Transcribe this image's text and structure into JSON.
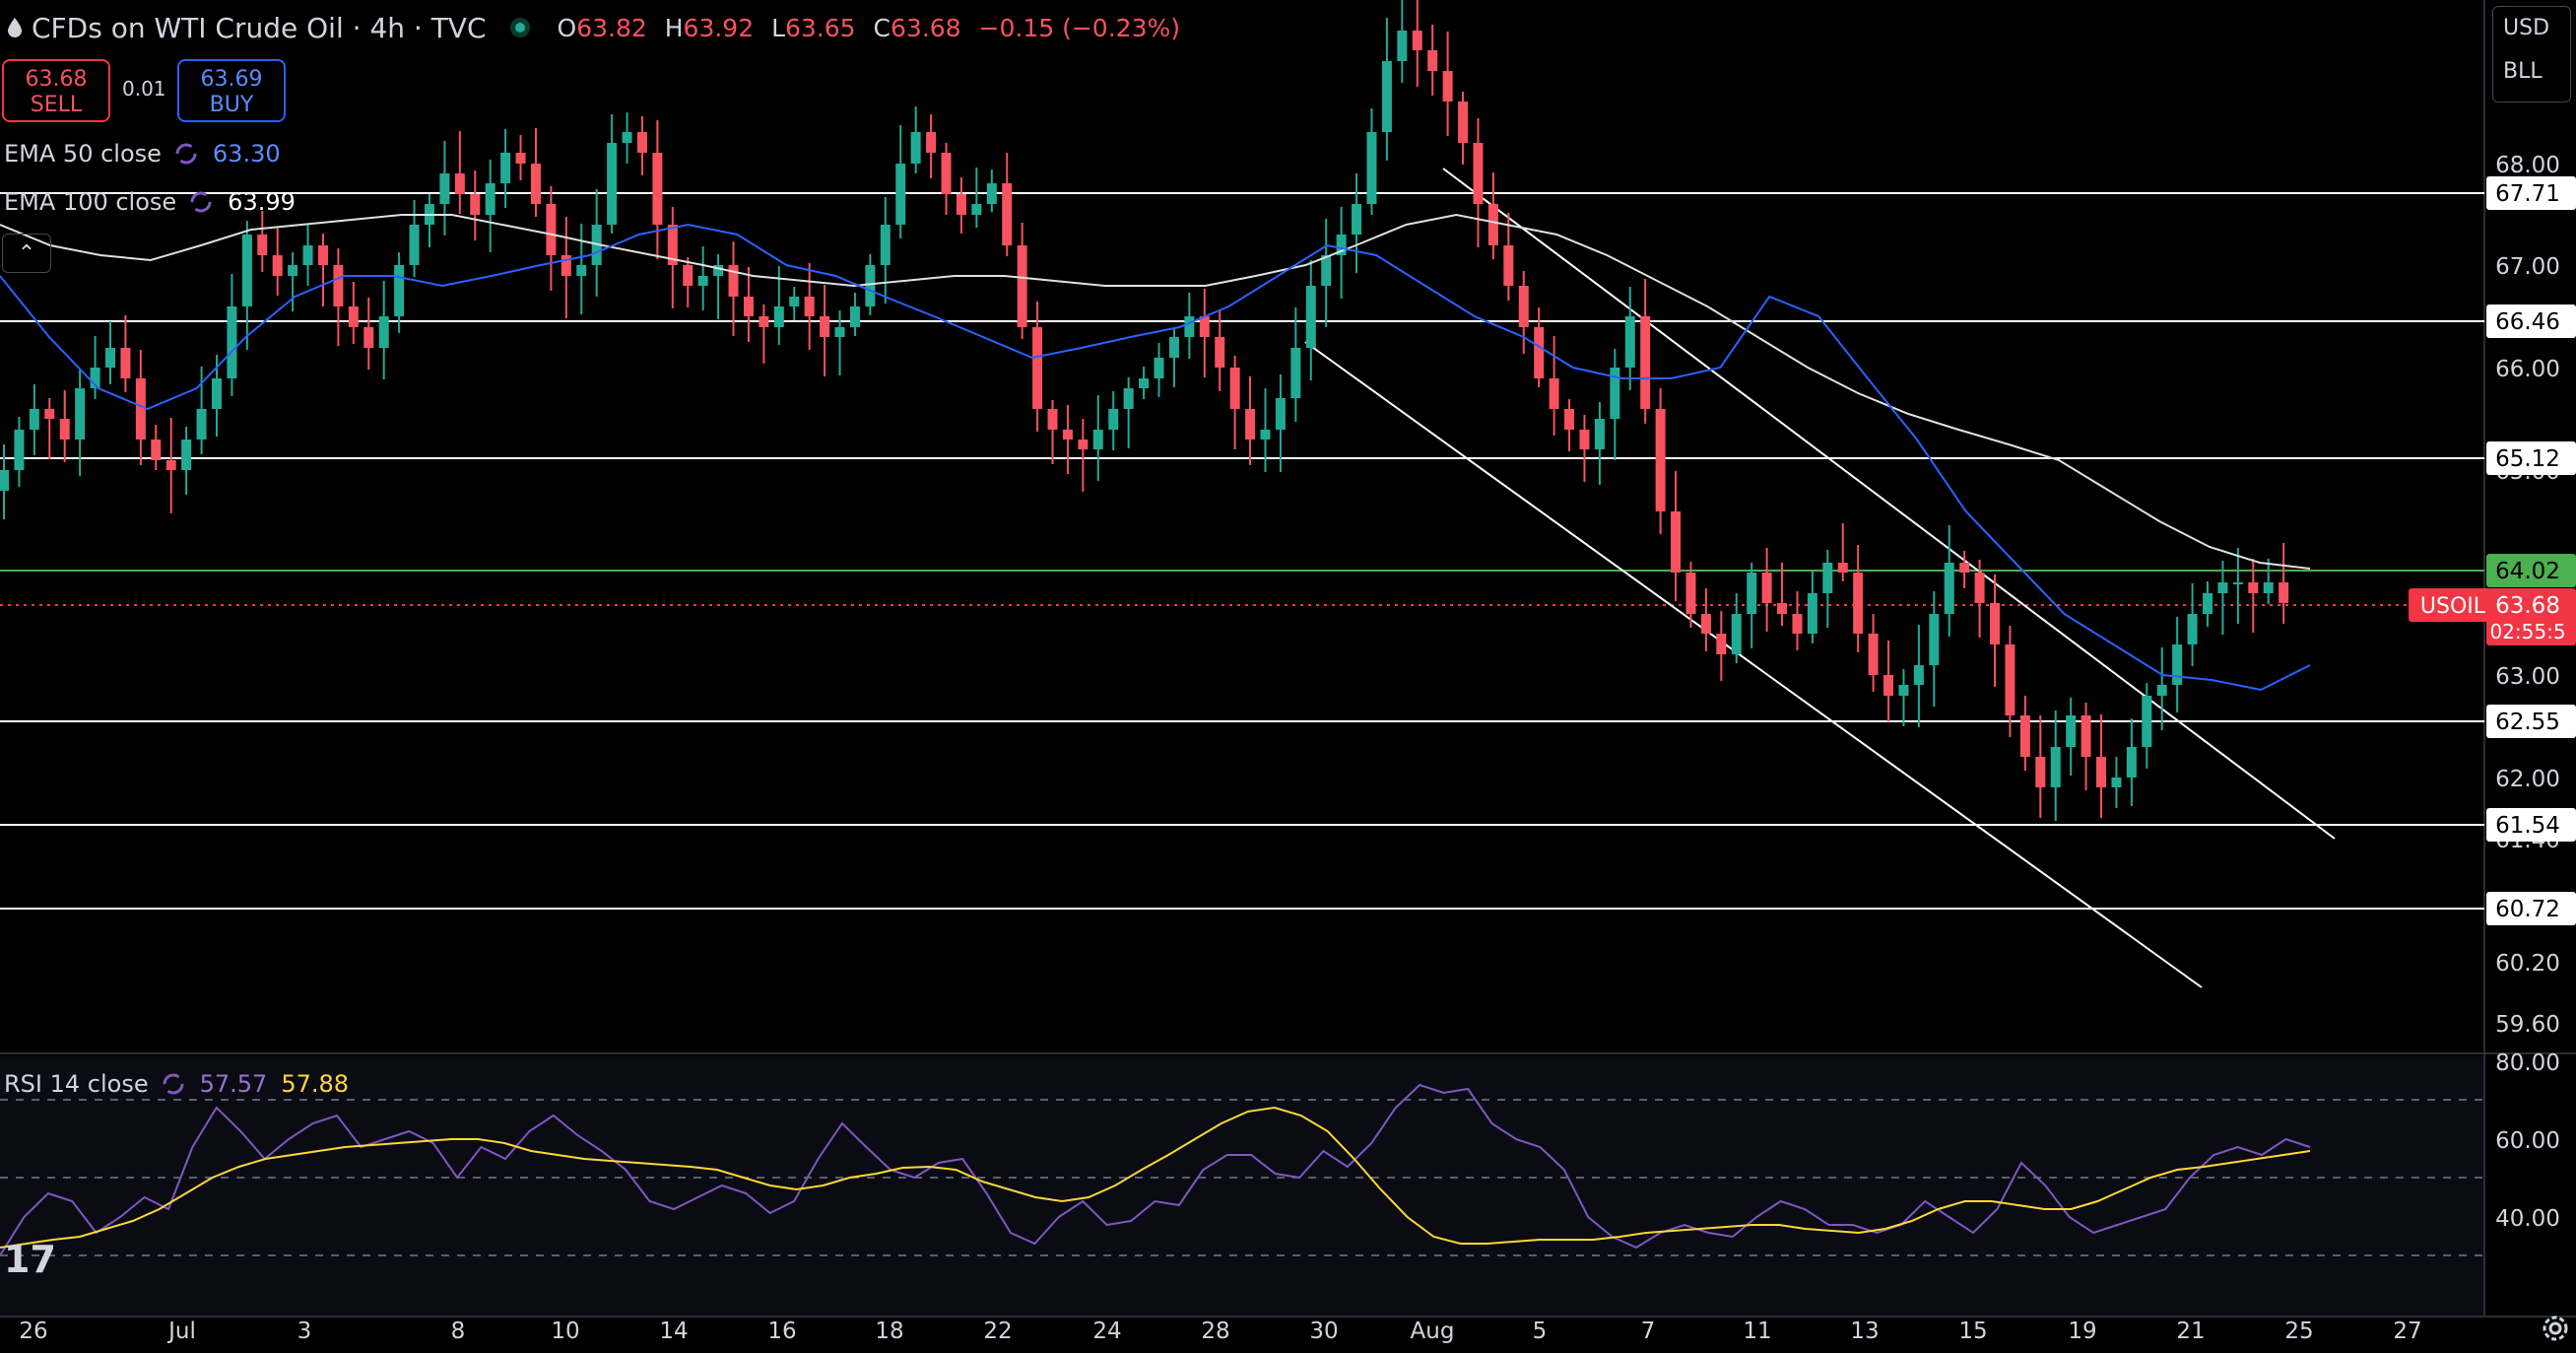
{
  "header": {
    "title": "CFDs on WTI Crude Oil · 4h · TVC",
    "open_label": "O",
    "open": "63.82",
    "high_label": "H",
    "high": "63.92",
    "low_label": "L",
    "low": "63.65",
    "close_label": "C",
    "close": "63.68",
    "change": "−0.15 (−0.23%)"
  },
  "trade": {
    "sell_price": "63.68",
    "sell_label": "SELL",
    "spread": "0.01",
    "buy_price": "63.69",
    "buy_label": "BUY"
  },
  "indicators": {
    "ema50_label": "EMA 50 close",
    "ema50_value": "63.30",
    "ema100_label": "EMA 100 close",
    "ema100_value": "63.99",
    "rsi_label": "RSI 14 close",
    "rsi_value": "57.57",
    "rsi_ma_value": "57.88"
  },
  "unit_box": {
    "currency": "USD",
    "unit": "BLL"
  },
  "colors": {
    "up": "#22ab94",
    "down": "#f7525f",
    "ema50": "#2962ff",
    "ema100": "#e0e0e0",
    "rsi": "#7e57c2",
    "rsi_ma": "#fdd835",
    "level": "#ffffff",
    "price_tag": "#f23645",
    "green_level": "#4caf50"
  },
  "icons": {
    "logo": "oil-drop-icon",
    "market_status": "market-open-dot-icon",
    "collapse": "chevron-up-icon",
    "brand": "tradingview-logo",
    "settings": "gear-icon"
  },
  "chart_data": {
    "type": "candlestick",
    "title": "CFDs on WTI Crude Oil · 4h · TVC",
    "y_axis": {
      "ticks": [
        "68.00",
        "67.00",
        "66.00",
        "65.00",
        "63.00",
        "62.00",
        "61.40",
        "60.20",
        "59.60"
      ],
      "ylim": [
        59.35,
        69.45
      ]
    },
    "x_axis": {
      "labels": [
        "26",
        "Jul",
        "3",
        "8",
        "10",
        "14",
        "16",
        "18",
        "22",
        "24",
        "28",
        "30",
        "Aug",
        "5",
        "7",
        "11",
        "13",
        "15",
        "19",
        "21",
        "25",
        "27"
      ]
    },
    "horizontal_levels": [
      "67.71",
      "66.46",
      "65.12",
      "62.55",
      "61.54",
      "60.72"
    ],
    "green_level": "64.02",
    "current_price": {
      "symbol": "USOIL",
      "price": "63.68",
      "countdown": "02:55:5"
    },
    "close_series": [
      65.0,
      65.4,
      65.6,
      65.5,
      65.3,
      65.8,
      66.0,
      66.2,
      65.9,
      65.3,
      65.1,
      65.0,
      65.3,
      65.6,
      65.9,
      66.6,
      67.3,
      67.1,
      66.9,
      67.0,
      67.2,
      67.0,
      66.6,
      66.4,
      66.2,
      66.5,
      67.0,
      67.4,
      67.6,
      67.9,
      67.7,
      67.5,
      67.8,
      68.1,
      68.0,
      67.6,
      67.1,
      66.9,
      67.0,
      67.4,
      68.2,
      68.3,
      68.1,
      67.4,
      67.0,
      66.8,
      66.9,
      67.0,
      66.7,
      66.5,
      66.4,
      66.6,
      66.7,
      66.5,
      66.3,
      66.4,
      66.6,
      67.0,
      67.4,
      68.0,
      68.3,
      68.1,
      67.7,
      67.5,
      67.6,
      67.8,
      67.2,
      66.4,
      65.6,
      65.4,
      65.3,
      65.2,
      65.4,
      65.6,
      65.8,
      65.9,
      66.1,
      66.3,
      66.5,
      66.3,
      66.0,
      65.6,
      65.3,
      65.4,
      65.7,
      66.2,
      66.8,
      67.1,
      67.3,
      67.6,
      68.3,
      69.0,
      69.3,
      69.1,
      68.9,
      68.6,
      68.2,
      67.6,
      67.2,
      66.8,
      66.4,
      65.9,
      65.6,
      65.4,
      65.2,
      65.5,
      66.0,
      66.5,
      65.6,
      64.6,
      64.0,
      63.6,
      63.4,
      63.2,
      63.6,
      64.0,
      63.7,
      63.6,
      63.4,
      63.8,
      64.1,
      64.0,
      63.4,
      63.0,
      62.8,
      62.9,
      63.1,
      63.6,
      64.1,
      64.0,
      63.7,
      63.3,
      62.6,
      62.2,
      61.9,
      62.3,
      62.6,
      62.2,
      61.9,
      62.0,
      62.3,
      62.8,
      62.9,
      63.3,
      63.6,
      63.8,
      63.9,
      63.9,
      63.8,
      63.9,
      63.7
    ],
    "ema50_series": [
      66.9,
      66.3,
      65.8,
      65.6,
      65.8,
      66.3,
      66.7,
      66.9,
      66.9,
      66.8,
      66.9,
      67.0,
      67.1,
      67.3,
      67.4,
      67.3,
      67.0,
      66.9,
      66.7,
      66.5,
      66.3,
      66.1,
      66.2,
      66.3,
      66.4,
      66.6,
      66.9,
      67.2,
      67.1,
      66.8,
      66.5,
      66.3,
      66.0,
      65.9,
      65.9,
      66.0,
      66.7,
      66.5,
      65.9,
      65.3,
      64.6,
      64.1,
      63.6,
      63.3,
      63.0,
      62.95,
      62.85,
      63.1
    ],
    "ema100_series": [
      67.4,
      67.2,
      67.1,
      67.05,
      67.2,
      67.35,
      67.4,
      67.45,
      67.5,
      67.5,
      67.4,
      67.3,
      67.2,
      67.1,
      67.0,
      66.9,
      66.85,
      66.8,
      66.85,
      66.9,
      66.9,
      66.85,
      66.8,
      66.8,
      66.8,
      66.9,
      67.0,
      67.2,
      67.4,
      67.5,
      67.4,
      67.3,
      67.1,
      66.85,
      66.6,
      66.3,
      66.0,
      65.75,
      65.55,
      65.4,
      65.25,
      65.1,
      64.8,
      64.5,
      64.25,
      64.1,
      64.04
    ],
    "trendlines": [
      {
        "label": "descending-trendline-upper",
        "from": [
          "Aug 1 (early)",
          67.95
        ],
        "to": [
          "Aug 25",
          61.4
        ]
      },
      {
        "label": "descending-trendline-lower",
        "from": [
          "Jul 28",
          66.25
        ],
        "to": [
          "Aug 22",
          59.95
        ]
      }
    ],
    "rsi": {
      "ticks": [
        "80.00",
        "60.00",
        "40.00"
      ],
      "levels": [
        70,
        50,
        30
      ],
      "ylim": [
        26,
        80
      ],
      "series": [
        30,
        40,
        46,
        44,
        36,
        40,
        45,
        42,
        58,
        68,
        62,
        55,
        60,
        64,
        66,
        58,
        60,
        62,
        59,
        50,
        58,
        55,
        62,
        66,
        61,
        57,
        52,
        44,
        42,
        45,
        48,
        46,
        41,
        44,
        55,
        64,
        58,
        52,
        50,
        54,
        55,
        46,
        36,
        33,
        40,
        44,
        38,
        39,
        44,
        43,
        52,
        56,
        56,
        51,
        50,
        57,
        53,
        59,
        68,
        74,
        72,
        73,
        64,
        60,
        58,
        52,
        40,
        35,
        32,
        36,
        38,
        36,
        35,
        40,
        44,
        42,
        38,
        38,
        36,
        38,
        44,
        40,
        36,
        42,
        54,
        48,
        40,
        36,
        38,
        40,
        42,
        50,
        56,
        58,
        56,
        60,
        58
      ],
      "ma_series": [
        32,
        33,
        34,
        35,
        37,
        39,
        42,
        46,
        50,
        53,
        55,
        56,
        57,
        58,
        58.5,
        59,
        59.5,
        60,
        60,
        59,
        57,
        56,
        55,
        54.5,
        54,
        53.5,
        53,
        52,
        50,
        48,
        47,
        48,
        50,
        51,
        52.5,
        53,
        52,
        49,
        47,
        45,
        44,
        45,
        48,
        52,
        56,
        60,
        64,
        67,
        68,
        66,
        62,
        55,
        47,
        40,
        35,
        33,
        33,
        33.5,
        34,
        34,
        34,
        35,
        36,
        36.5,
        37,
        37.5,
        38,
        38,
        37,
        36.5,
        36,
        37,
        39,
        42,
        44,
        44,
        43,
        42,
        42,
        44,
        47,
        50,
        52,
        53,
        54,
        55,
        56,
        57
      ]
    }
  }
}
